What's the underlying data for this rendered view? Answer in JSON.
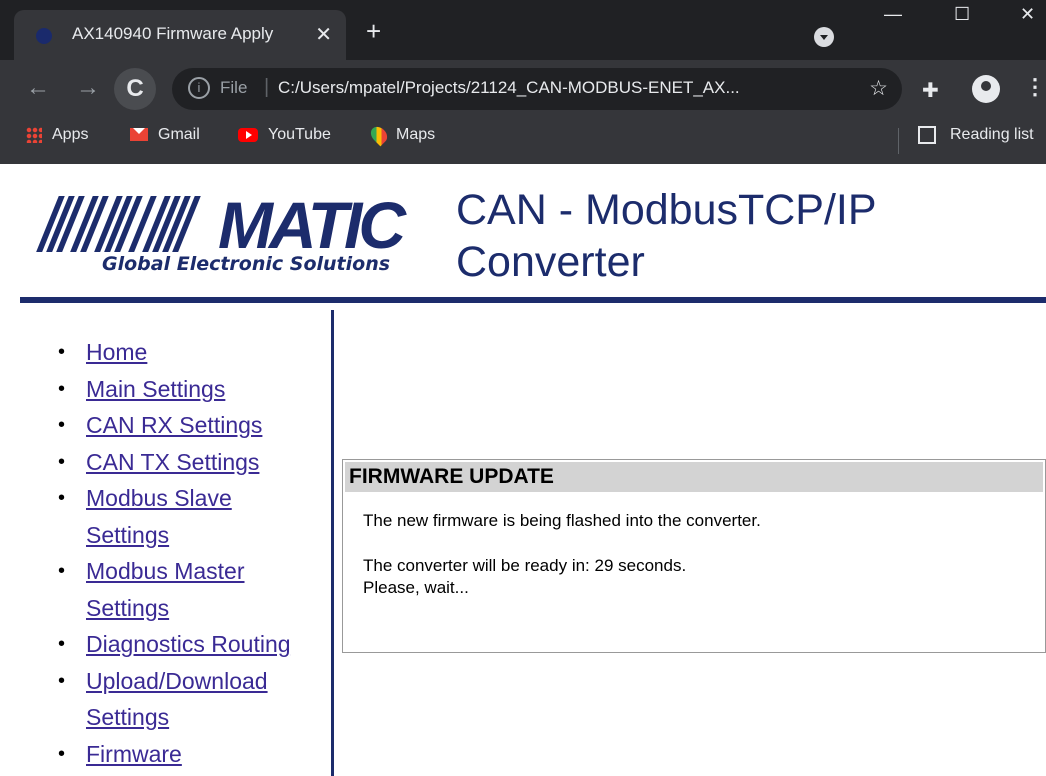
{
  "browser": {
    "tab_title": "AX140940 Firmware Apply",
    "tab_close": "✕",
    "new_tab": "+",
    "scheme": "File",
    "url": "C:/Users/mpatel/Projects/21124_CAN-MODBUS-ENET_AX...",
    "bookmarks": [
      {
        "label": "Apps",
        "icon": "apps-grid-icon"
      },
      {
        "label": "Gmail",
        "icon": "gmail-icon"
      },
      {
        "label": "YouTube",
        "icon": "youtube-icon"
      },
      {
        "label": "Maps",
        "icon": "maps-icon"
      }
    ],
    "reading_list": "Reading list"
  },
  "header": {
    "logo_tagline": "Global Electronic Solutions",
    "title_line1": "CAN - ModbusTCP/IP",
    "title_line2": "Converter",
    "brand_color": "#1c2c6c"
  },
  "nav": {
    "items": [
      {
        "label": "Home"
      },
      {
        "label": "Main Settings"
      },
      {
        "label": "CAN RX Settings"
      },
      {
        "label": "CAN TX Settings"
      },
      {
        "label": "Modbus Slave Settings"
      },
      {
        "label": "Modbus Master Settings"
      },
      {
        "label": "Diagnostics Routing"
      },
      {
        "label": "Upload/Download Settings"
      },
      {
        "label": "Firmware"
      }
    ]
  },
  "panel": {
    "heading": "FIRMWARE UPDATE",
    "message": "The new firmware is being flashed into the converter.",
    "countdown": "The converter will be ready in: 29 seconds.",
    "wait": "Please, wait..."
  }
}
